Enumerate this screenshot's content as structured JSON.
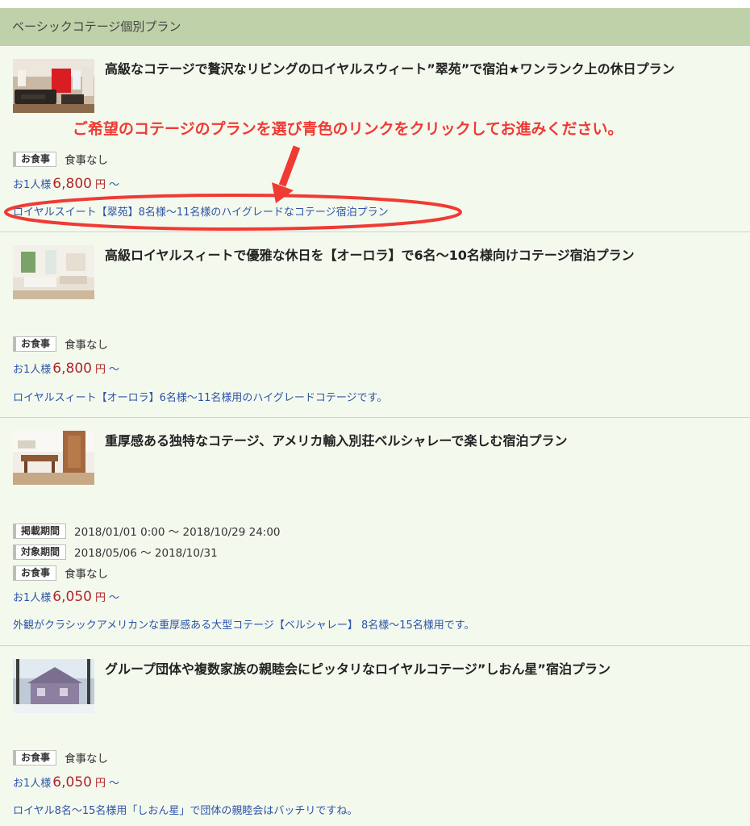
{
  "section": {
    "title": "ベーシックコテージ個別プラン"
  },
  "annotation": {
    "text": "ご希望のコテージのプランを選び青色のリンクをクリックしてお進みください。",
    "color": "#f03a34"
  },
  "labels": {
    "meal": "お食事",
    "posting_period": "掲載期間",
    "target_period": "対象期間",
    "per_person": "お1人様",
    "yen": "円",
    "from": "～"
  },
  "plans": [
    {
      "title": "高級なコテージで贅沢なリビングのロイヤルスウィート”翠苑”で宿泊★ワンランク上の休日プラン",
      "meal": "食事なし",
      "price": "6,800",
      "link": "ロイヤルスイート【翠苑】8名様～11名様のハイグレードなコテージ宿泊プラン"
    },
    {
      "title": "高級ロイヤルスィートで優雅な休日を【オーロラ】で6名～10名様向けコテージ宿泊プラン",
      "meal": "食事なし",
      "price": "6,800",
      "link": "ロイヤルスィート【オーロラ】6名様～11名様用のハイグレードコテージです。"
    },
    {
      "title": "重厚感ある独特なコテージ、アメリカ輸入別荘ベルシャレーで楽しむ宿泊プラン",
      "posting_period": "2018/01/01 0:00 ～ 2018/10/29 24:00",
      "target_period": "2018/05/06 ～ 2018/10/31",
      "meal": "食事なし",
      "price": "6,050",
      "link": "外観がクラシックアメリカンな重厚感ある大型コテージ【ベルシャレー】 8名様～15名様用です。"
    },
    {
      "title": "グループ団体や複数家族の親睦会にピッタリなロイヤルコテージ”しおん星”宿泊プラン",
      "meal": "食事なし",
      "price": "6,050",
      "link": "ロイヤル8名～15名様用「しおん星」で団体の親睦会はバッチリですね。"
    }
  ]
}
